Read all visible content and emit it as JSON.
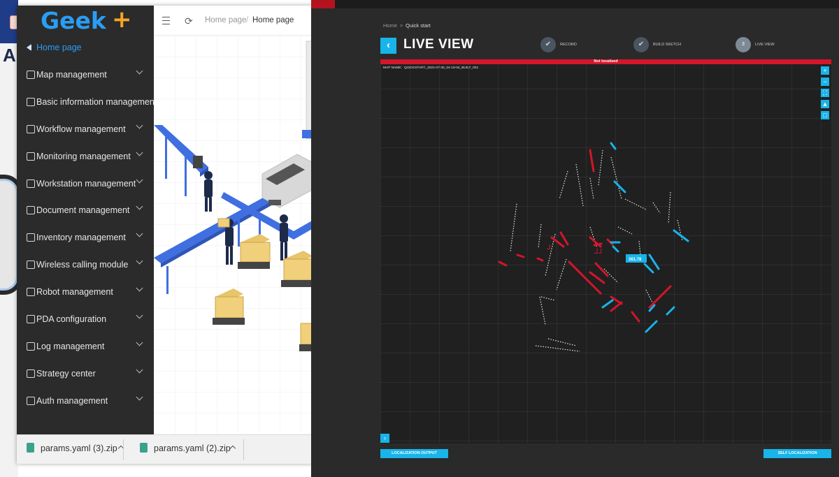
{
  "geek_window": {
    "logo": {
      "text": "Geek",
      "plus": "+"
    },
    "menu": [
      {
        "label": "Home page",
        "icon": "home-icon",
        "active": true,
        "has_children": false
      },
      {
        "label": "Map management",
        "icon": "map-icon",
        "has_children": true
      },
      {
        "label": "Basic information management",
        "icon": "cube-icon",
        "has_children": false
      },
      {
        "label": "Workflow management",
        "icon": "workflow-icon",
        "has_children": true
      },
      {
        "label": "Monitoring management",
        "icon": "monitor-icon",
        "has_children": true
      },
      {
        "label": "Workstation management",
        "icon": "desktop-icon",
        "has_children": true
      },
      {
        "label": "Document management",
        "icon": "document-icon",
        "has_children": true
      },
      {
        "label": "Inventory management",
        "icon": "inventory-icon",
        "has_children": true
      },
      {
        "label": "Wireless calling module",
        "icon": "wireless-icon",
        "has_children": true
      },
      {
        "label": "Robot management",
        "icon": "robot-icon",
        "has_children": true
      },
      {
        "label": "PDA configuration",
        "icon": "pda-icon",
        "has_children": true
      },
      {
        "label": "Log management",
        "icon": "log-icon",
        "has_children": true
      },
      {
        "label": "Strategy center",
        "icon": "strategy-icon",
        "has_children": true
      },
      {
        "label": "Auth management",
        "icon": "user-icon",
        "has_children": true
      }
    ],
    "breadcrumb": {
      "home": "Home page",
      "separator": "/",
      "current": "Home page"
    },
    "colors": {
      "sidebar": "#2b2b2b",
      "accent": "#2a9df4",
      "logo_plus": "#f6a623",
      "illustration_blue": "#3f6fe0"
    }
  },
  "downloads": [
    {
      "name": "params.yaml (3).zip",
      "icon": "zip-file-icon"
    },
    {
      "name": "params.yaml (2).zip",
      "icon": "zip-file-icon"
    }
  ],
  "live_window": {
    "breadcrumb": {
      "home": "Home",
      "separator": ">",
      "current": "Quick start"
    },
    "title": "LIVE VIEW",
    "steps": [
      {
        "label": "RECORD",
        "state": "done",
        "marker": "✔"
      },
      {
        "label": "BUILD SKETCH",
        "state": "done",
        "marker": "✔"
      },
      {
        "label": "LIVE VIEW",
        "state": "current",
        "marker": "3"
      }
    ],
    "alert": "Not localised",
    "map_name_label": "MAP NAME:",
    "map_name": "QUICKSTART_2021-07-30_04-19-04_BUILT_001",
    "robot_label": "361.78",
    "tools": [
      "zoom-in-icon",
      "zoom-out-icon",
      "fit-icon",
      "navigate-icon",
      "select-icon"
    ],
    "buttons": {
      "localization_output": "LOCALIZATION OUTPUT",
      "self_localization": "SELF LOCALIZATION"
    },
    "colors": {
      "accent": "#18b4ea",
      "alert": "#d4152a",
      "scan_red": "#d4152a",
      "scan_cyan": "#18b4ea"
    }
  }
}
